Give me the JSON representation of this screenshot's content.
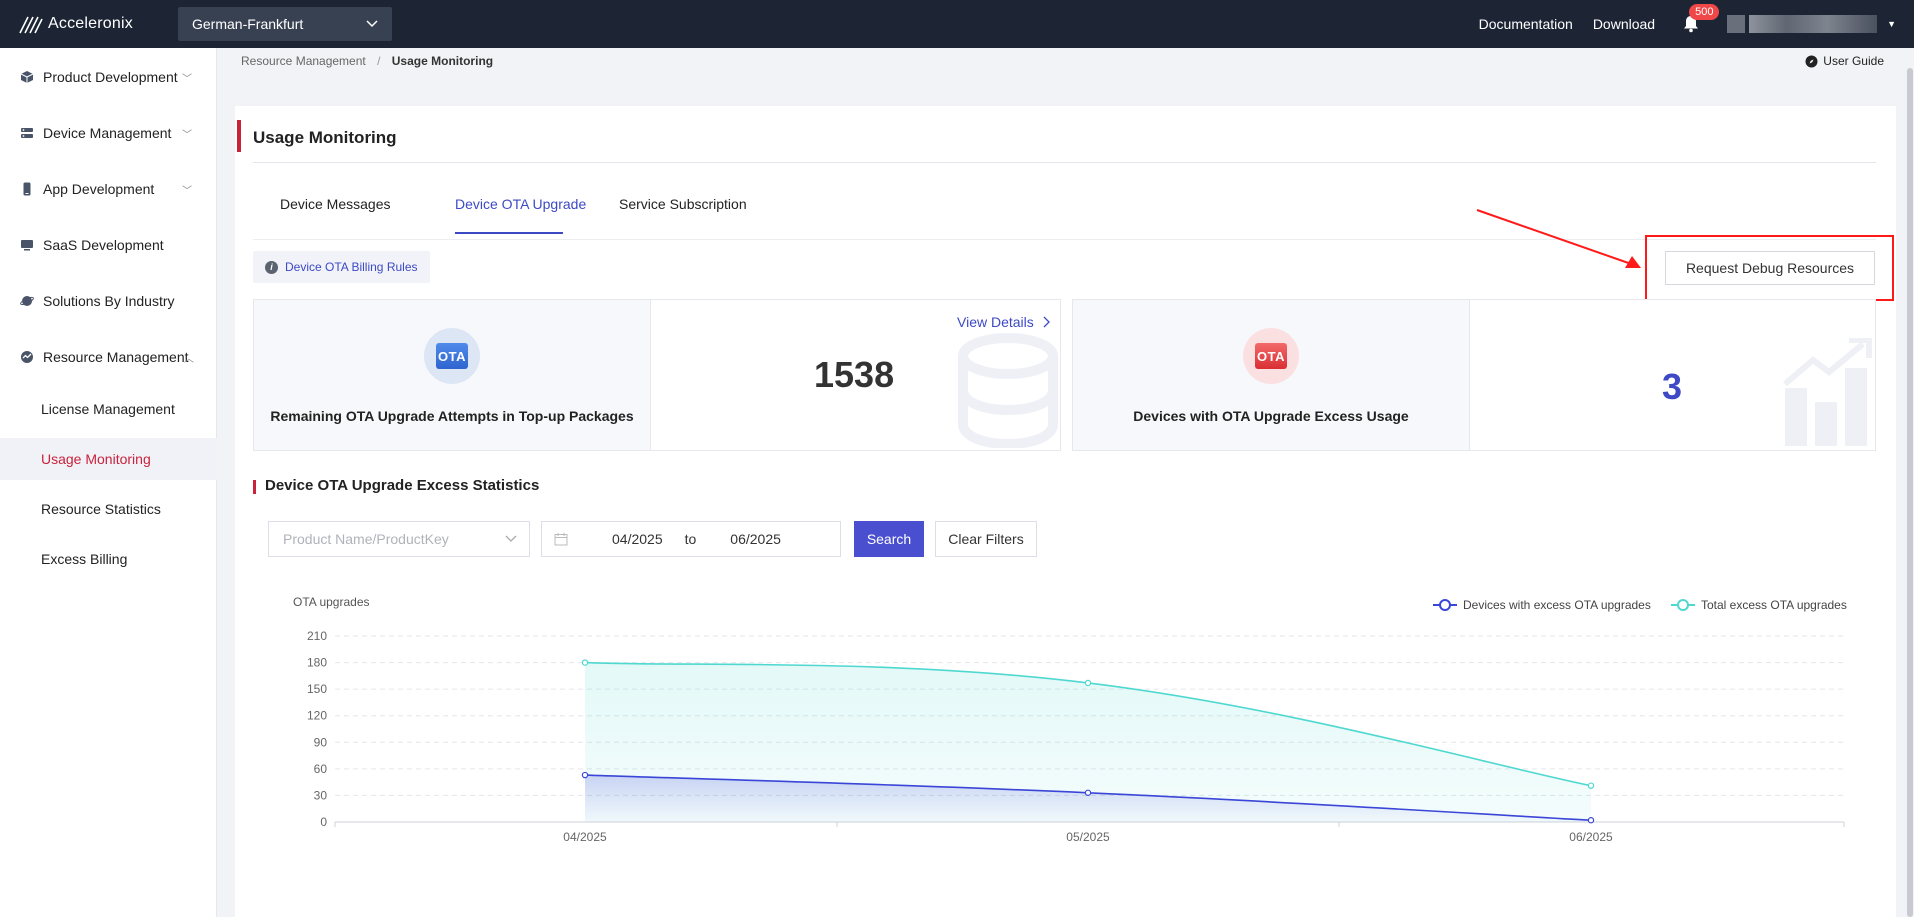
{
  "topbar": {
    "logo_text": "Acceleronix",
    "region": "German-Frankfurt",
    "documentation": "Documentation",
    "download": "Download",
    "notification_count": "500"
  },
  "sidebar": {
    "items": [
      {
        "label": "Product Development",
        "icon": "cube-icon"
      },
      {
        "label": "Device Management",
        "icon": "server-icon"
      },
      {
        "label": "App Development",
        "icon": "phone-icon"
      },
      {
        "label": "SaaS Development",
        "icon": "monitor-icon"
      },
      {
        "label": "Solutions By Industry",
        "icon": "planet-icon"
      },
      {
        "label": "Resource Management",
        "icon": "gauge-icon"
      }
    ],
    "sub_items": [
      "License Management",
      "Usage Monitoring",
      "Resource Statistics",
      "Excess Billing"
    ],
    "active_sub": "Usage Monitoring"
  },
  "breadcrumb": {
    "parent": "Resource Management",
    "separator": "/",
    "current": "Usage Monitoring"
  },
  "user_guide": "User Guide",
  "page": {
    "title": "Usage Monitoring",
    "tabs": [
      "Device Messages",
      "Device OTA Upgrade",
      "Service Subscription"
    ],
    "active_tab": "Device OTA Upgrade",
    "billing_rules": "Device OTA Billing Rules",
    "request_debug": "Request Debug Resources"
  },
  "stats": [
    {
      "icon_text": "OTA",
      "label": "Remaining OTA Upgrade Attempts in Top-up Packages",
      "value": "1538",
      "link": "View Details"
    },
    {
      "icon_text": "OTA",
      "label": "Devices with OTA Upgrade Excess Usage",
      "value": "3"
    }
  ],
  "colors": {
    "accent": "#3d49c5",
    "brand_red": "#c9223a",
    "series_devices": "#3b46d8",
    "series_total": "#4fd8d0"
  },
  "section": {
    "title": "Device OTA Upgrade Excess Statistics"
  },
  "filters": {
    "product_placeholder": "Product Name/ProductKey",
    "date_from": "04/2025",
    "date_to_label": "to",
    "date_to": "06/2025",
    "search": "Search",
    "clear": "Clear Filters"
  },
  "chart_data": {
    "type": "area",
    "ylabel": "OTA upgrades",
    "categories": [
      "04/2025",
      "05/2025",
      "06/2025"
    ],
    "yticks": [
      "0",
      "30",
      "60",
      "90",
      "120",
      "150",
      "180",
      "210"
    ],
    "ylim": [
      0,
      210
    ],
    "legend_position": "top-right",
    "grid": true,
    "series": [
      {
        "name": "Devices with excess OTA upgrades",
        "values": [
          53,
          33,
          2
        ]
      },
      {
        "name": "Total excess OTA upgrades",
        "values": [
          180,
          157,
          41
        ]
      }
    ]
  }
}
